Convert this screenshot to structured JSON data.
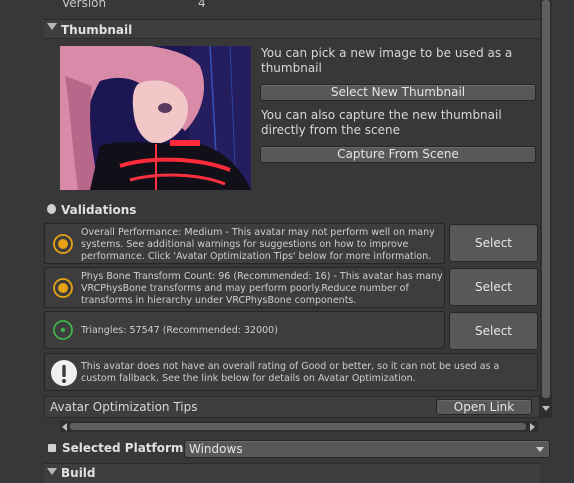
{
  "version": {
    "label": "Version",
    "value": "4"
  },
  "thumbnail": {
    "header": "Thumbnail",
    "pick_text": "You can pick a new image to be used as a thumbnail",
    "select_button": "Select New Thumbnail",
    "capture_text": "You can also capture the new thumbnail directly from the scene",
    "capture_button": "Capture From Scene"
  },
  "validations": {
    "header": "Validations",
    "items": [
      {
        "text": "Overall Performance: Medium - This avatar may not perform well on many systems. See additional warnings for suggestions on how to improve performance. Click 'Avatar Optimization Tips' below for more information.",
        "button": "Select",
        "icon": "warning-circle-icon",
        "color": "#e8a315"
      },
      {
        "text": "Phys Bone Transform Count: 96 (Recommended: 16) - This avatar has many VRCPhysBone transforms and may perform poorly.Reduce number of transforms in hierarchy under VRCPhysBone components.",
        "button": "Select",
        "icon": "warning-circle-icon",
        "color": "#e8a315"
      },
      {
        "text": "Triangles: 57547 (Recommended: 32000)",
        "button": "Select",
        "icon": "good-circle-icon",
        "color": "#3fb24a"
      }
    ],
    "notice": "This avatar does not have an overall rating of Good or better, so it can not be used as a custom fallback. See the link below for details on Avatar Optimization.",
    "tips_label": "Avatar Optimization Tips",
    "tips_button": "Open Link"
  },
  "platform": {
    "label": "Selected Platform",
    "value": "Windows"
  },
  "build": {
    "header": "Build"
  }
}
